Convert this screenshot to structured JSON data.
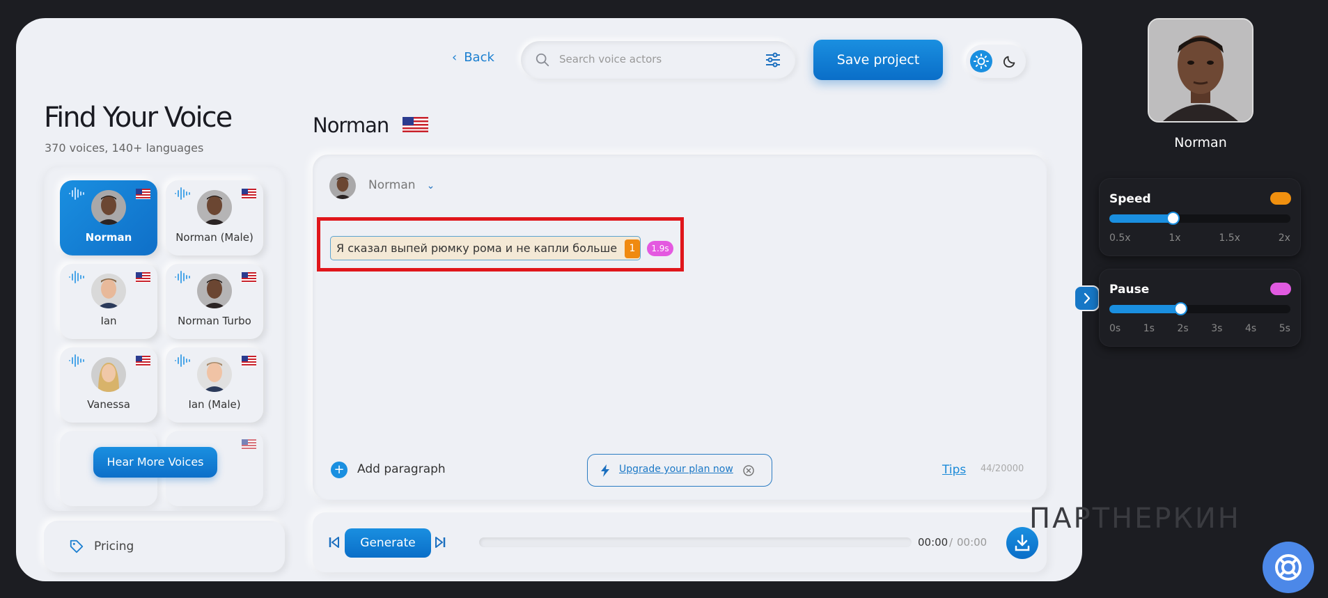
{
  "sidebar": {
    "title": "Find Your Voice",
    "subtitle": "370 voices, 140+ languages",
    "voices": [
      {
        "name": "Norman",
        "selected": true
      },
      {
        "name": "Norman (Male)",
        "selected": false
      },
      {
        "name": "Ian",
        "selected": false
      },
      {
        "name": "Norman Turbo",
        "selected": false
      },
      {
        "name": "Vanessa",
        "selected": false
      },
      {
        "name": "Ian (Male)",
        "selected": false
      }
    ],
    "hear_more": "Hear More Voices",
    "pricing": "Pricing"
  },
  "header": {
    "back": "Back",
    "search_placeholder": "Search voice actors",
    "save": "Save project"
  },
  "editor": {
    "voice_title": "Norman",
    "selected_voice": "Norman",
    "paragraph_text": "Я сказал выпей рюмку рома и не капли больше",
    "paragraph_number": "1",
    "duration": "1.9s",
    "add_paragraph": "Add paragraph",
    "upgrade": "Upgrade your plan now",
    "tips": "Tips",
    "counter": "44/20000"
  },
  "player": {
    "generate": "Generate",
    "current": "00:00",
    "separator": "/",
    "total": "00:00"
  },
  "right_panel": {
    "name": "Norman",
    "speed": {
      "label": "Speed",
      "ticks": [
        "0.5x",
        "1x",
        "1.5x",
        "2x"
      ],
      "value": "1x",
      "color": "#f0900f"
    },
    "pause": {
      "label": "Pause",
      "ticks": [
        "0s",
        "1s",
        "2s",
        "3s",
        "4s",
        "5s"
      ],
      "value": "2s",
      "color": "#e05ae0"
    }
  },
  "watermark": "ПАРТНЕРКИН",
  "colors": {
    "accent": "#1a8fe0",
    "highlight": "#e0161b"
  }
}
